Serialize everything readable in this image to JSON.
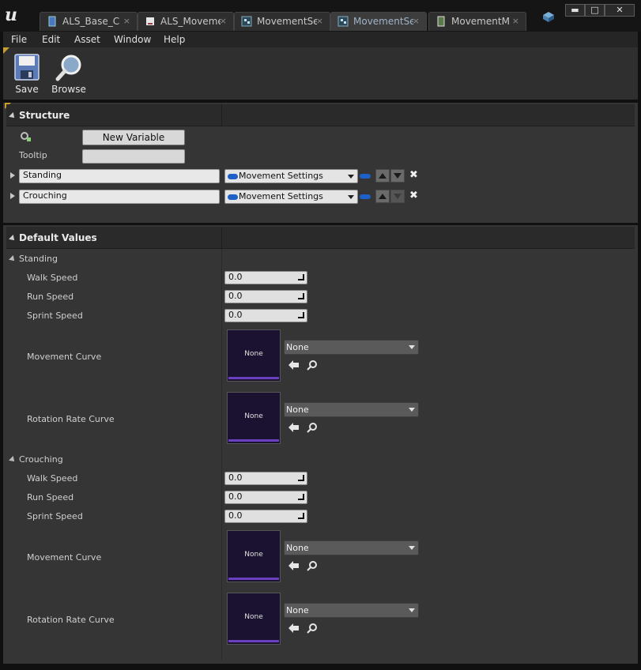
{
  "tabs": [
    {
      "label": "ALS_Base_C",
      "icon": "blueprint-icon",
      "active": false
    },
    {
      "label": "ALS_Moveme",
      "icon": "document-icon",
      "active": false
    },
    {
      "label": "MovementSet",
      "icon": "struct-icon",
      "active": false
    },
    {
      "label": "MovementSet",
      "icon": "struct-icon",
      "active": true
    },
    {
      "label": "MovementM",
      "icon": "data-asset-icon",
      "active": false
    }
  ],
  "tab_close": "×",
  "window_controls": {
    "minimize": "▬",
    "maximize": "□",
    "close": "✕"
  },
  "menu": [
    "File",
    "Edit",
    "Asset",
    "Window",
    "Help"
  ],
  "toolbar": {
    "save_label": "Save",
    "browse_label": "Browse"
  },
  "structure": {
    "title": "Structure",
    "new_variable_label": "New Variable",
    "tooltip_label": "Tooltip",
    "tooltip_value": "",
    "members": [
      {
        "name": "Standing",
        "type": "Movement Settings"
      },
      {
        "name": "Crouching",
        "type": "Movement Settings"
      }
    ],
    "delete_glyph": "✖"
  },
  "defaults": {
    "title": "Default Values",
    "groups": [
      {
        "name": "Standing",
        "walk_label": "Walk Speed",
        "walk_value": "0.0",
        "run_label": "Run Speed",
        "run_value": "0.0",
        "sprint_label": "Sprint Speed",
        "sprint_value": "0.0",
        "movement_curve_label": "Movement Curve",
        "movement_curve_thumb": "None",
        "movement_curve_value": "None",
        "rotation_curve_label": "Rotation Rate Curve",
        "rotation_curve_thumb": "None",
        "rotation_curve_value": "None"
      },
      {
        "name": "Crouching",
        "walk_label": "Walk Speed",
        "walk_value": "0.0",
        "run_label": "Run Speed",
        "run_value": "0.0",
        "sprint_label": "Sprint Speed",
        "sprint_value": "0.0",
        "movement_curve_label": "Movement Curve",
        "movement_curve_thumb": "None",
        "movement_curve_value": "None",
        "rotation_curve_label": "Rotation Rate Curve",
        "rotation_curve_thumb": "None",
        "rotation_curve_value": "None"
      }
    ]
  },
  "colors": {
    "accent_blue": "#1e5fc8",
    "curve_purple": "#6a3fc0",
    "corner_gold": "#c8a030"
  }
}
